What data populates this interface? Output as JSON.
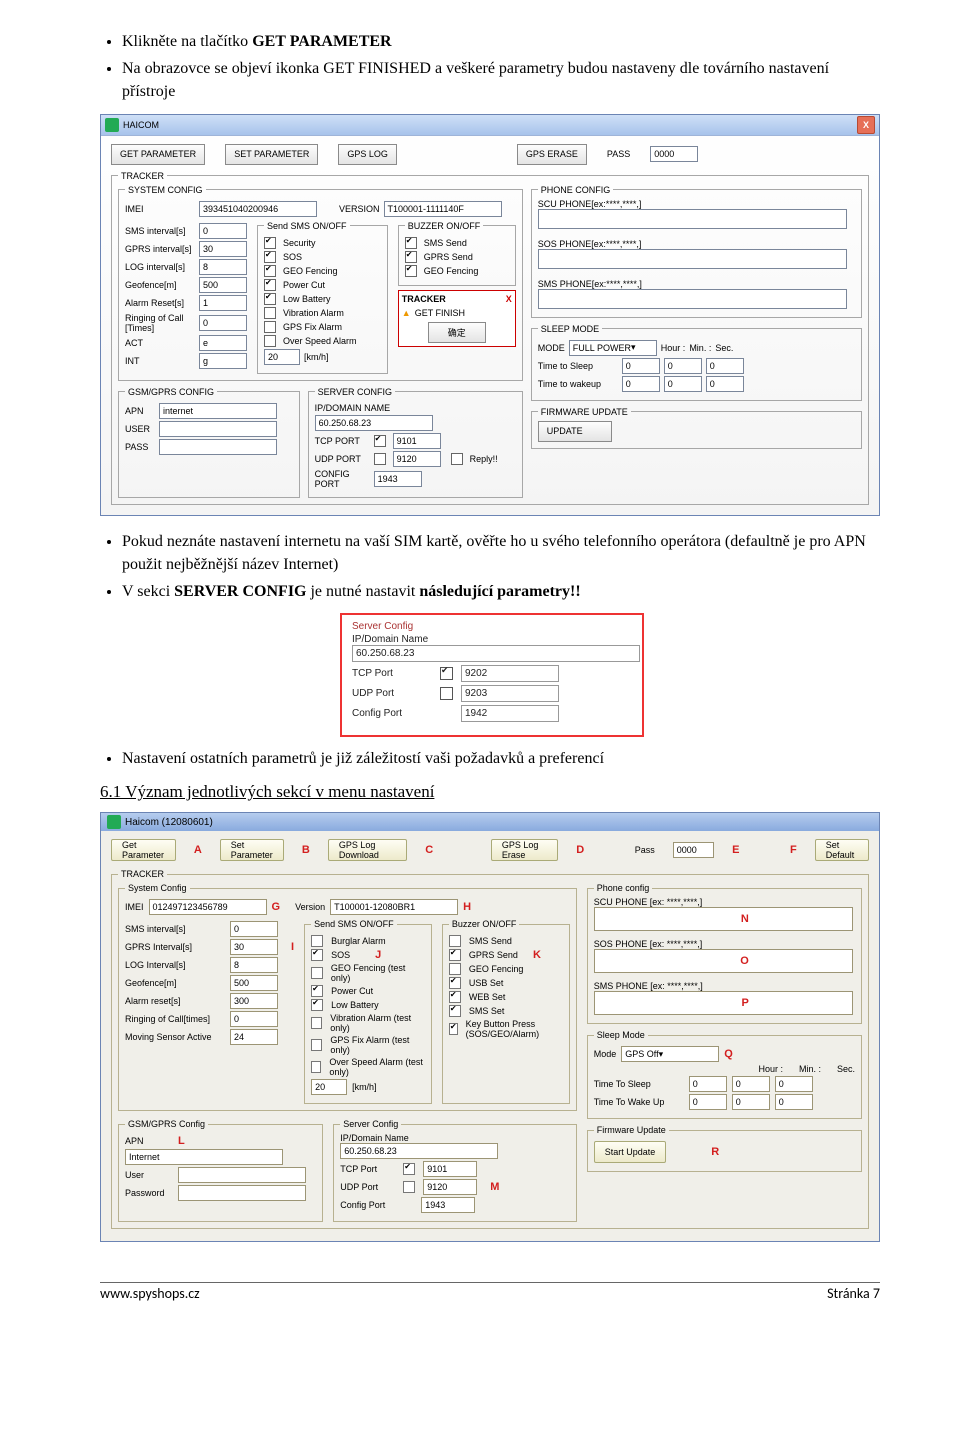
{
  "doc": {
    "bullet1_a": "Klikněte na tlačítko ",
    "bullet1_b": "GET PARAMETER",
    "bullet2": "Na obrazovce se objeví ikonka GET FINISHED a veškeré parametry budou nastaveny dle továrního nastavení přístroje",
    "bullet3": "Pokud neznáte nastavení internetu na vaší SIM kartě, ověřte ho u svého telefonního operátora (defaultně je pro APN použit nejběžnější název Internet)",
    "bullet4_a": "V sekci ",
    "bullet4_b": "SERVER CONFIG",
    "bullet4_c": " je nutné nastavit ",
    "bullet4_d": "následující parametry!!",
    "bullet5": "Nastavení ostatních parametrů je již záležitostí vaši požadavků a preferencí",
    "section61": "6.1 Význam jednotlivých sekcí v menu nastavení"
  },
  "shot1": {
    "title": "HAICOM",
    "btn_get": "GET PARAMETER",
    "btn_set": "SET PARAMETER",
    "btn_log": "GPS LOG",
    "btn_erase": "GPS ERASE",
    "pass_label": "PASS",
    "pass_value": "0000",
    "tracker": "TRACKER",
    "system_config": "SYSTEM CONFIG",
    "imei_lbl": "IMEI",
    "imei_val": "393451040200946",
    "version_lbl": "VERSION",
    "version_val": "T100001-1111140F",
    "fields": [
      {
        "l": "SMS interval[s]",
        "v": "0"
      },
      {
        "l": "GPRS interval[s]",
        "v": "30"
      },
      {
        "l": "LOG interval[s]",
        "v": "8"
      },
      {
        "l": "Geofence[m]",
        "v": "500"
      },
      {
        "l": "Alarm Reset[s]",
        "v": "1"
      },
      {
        "l": "Ringing of Call [Times]",
        "v": "0"
      },
      {
        "l": "ACT",
        "v": "e"
      },
      {
        "l": "INT",
        "v": "g"
      }
    ],
    "send_title": "Send SMS ON/OFF",
    "send_items": [
      "Security",
      "SOS",
      "GEO Fencing",
      "Power Cut",
      "Low Battery",
      "Vibration Alarm",
      "GPS Fix Alarm",
      "Over Speed Alarm"
    ],
    "send_checked": [
      true,
      true,
      true,
      true,
      true,
      false,
      false,
      false
    ],
    "speed_val": "20",
    "speed_unit": "[km/h]",
    "buzzer_title": "BUZZER ON/OFF",
    "buzzer_items": [
      "SMS Send",
      "GPRS Send",
      "GEO Fencing"
    ],
    "buzzer_checked": [
      true,
      true,
      true
    ],
    "popup_title": "TRACKER",
    "popup_msg": "GET FINISH",
    "phone_config": "PHONE CONFIG",
    "scu_lbl": "SCU PHONE[ex:****,****,]",
    "sos_lbl": "SOS PHONE[ex:****,****,]",
    "sms_lbl": "SMS PHONE[ex:****,****,]",
    "gsm_title": "GSM/GPRS CONFIG",
    "apn_lbl": "APN",
    "apn_val": "internet",
    "user_lbl": "USER",
    "pass_lbl": "PASS",
    "server_title": "SERVER CONFIG",
    "ipdn_lbl": "IP/DOMAIN NAME",
    "ipdn_val": "60.250.68.23",
    "tcp_lbl": "TCP PORT",
    "tcp_val": "9101",
    "udp_lbl": "UDP PORT",
    "udp_val": "9120",
    "cfg_lbl": "CONFIG PORT",
    "cfg_val": "1943",
    "replyq": "Reply!!",
    "sleep_title": "SLEEP MODE",
    "mode_lbl": "MODE",
    "mode_val": "FULL POWER",
    "hour": "Hour :",
    "min": "Min. :",
    "sec": "Sec.",
    "tts": "Time to Sleep",
    "ttw": "Time to wakeup",
    "zero": "0",
    "fw_title": "FIRMWARE UPDATE",
    "update": "UPDATE"
  },
  "shot2": {
    "title": "Server Config",
    "ipdn_lbl": "IP/Domain Name",
    "ipdn_val": "60.250.68.23",
    "tcp_lbl": "TCP Port",
    "tcp_val": "9202",
    "udp_lbl": "UDP Port",
    "udp_val": "9203",
    "cfg_lbl": "Config Port",
    "cfg_val": "1942"
  },
  "shot3": {
    "title": "Haicom (12080601)",
    "btn_get": "Get Parameter",
    "btn_set": "Set Parameter",
    "btn_dl": "GPS Log Download",
    "btn_er": "GPS Log Erase",
    "pass_lbl": "Pass",
    "pass_val": "0000",
    "btn_def": "Set Default",
    "letters": {
      "A": "A",
      "B": "B",
      "C": "C",
      "D": "D",
      "E": "E",
      "F": "F",
      "G": "G",
      "H": "H",
      "I": "I",
      "J": "J",
      "K": "K",
      "L": "L",
      "M": "M",
      "N": "N",
      "O": "O",
      "P": "P",
      "Q": "Q",
      "R": "R"
    },
    "tracker": "TRACKER",
    "syscfg": "System Config",
    "imei_lbl": "IMEI",
    "imei_val": "012497123456789",
    "ver_lbl": "Version",
    "ver_val": "T100001-12080BR1",
    "leftfields": [
      {
        "l": "SMS interval[s]",
        "v": "0"
      },
      {
        "l": "GPRS Interval[s]",
        "v": "30"
      },
      {
        "l": "LOG Interval[s]",
        "v": "8"
      },
      {
        "l": "Geofence[m]",
        "v": "500"
      },
      {
        "l": "Alarm reset[s]",
        "v": "300"
      },
      {
        "l": "Ringing of Call[times]",
        "v": "0"
      },
      {
        "l": "Moving Sensor Active",
        "v": "24"
      }
    ],
    "sendtitle": "Send SMS ON/OFF",
    "senditems": [
      "Burglar Alarm",
      "SOS",
      "GEO Fencing (test only)",
      "Power Cut",
      "Low Battery",
      "Vibration Alarm (test only)",
      "GPS Fix Alarm (test only)",
      "Over Speed Alarm (test only)"
    ],
    "sendchecked": [
      false,
      true,
      false,
      true,
      true,
      false,
      false,
      false
    ],
    "speed": "20",
    "speedunit": "[km/h]",
    "buztitle": "Buzzer ON/OFF",
    "buzitems": [
      "SMS Send",
      "GPRS Send",
      "GEO Fencing",
      "USB Set",
      "WEB Set",
      "SMS Set",
      "Key Button Press (SOS/GEO/Alarm)"
    ],
    "buzchecked": [
      false,
      true,
      false,
      true,
      true,
      true,
      true
    ],
    "phonecfg": "Phone config",
    "scu": "SCU PHONE [ex: ****,****,]",
    "sos": "SOS PHONE [ex: ****,****,]",
    "sms": "SMS PHONE [ex: ****,****,]",
    "gsm": "GSM/GPRS Config",
    "apn": "APN",
    "apn_val": "Internet",
    "user": "User",
    "pwd": "Password",
    "srv": "Server Config",
    "ipdn": "IP/Domain Name",
    "ipdn_val": "60.250.68.23",
    "tcp": "TCP Port",
    "tcp_val": "9101",
    "udp": "UDP Port",
    "udp_val": "9120",
    "cfg": "Config Port",
    "cfg_val": "1943",
    "sleep": "Sleep Mode",
    "mode": "Mode",
    "mode_val": "GPS Off",
    "hour": "Hour :",
    "min": "Min. :",
    "sec": "Sec.",
    "tts": "Time To Sleep",
    "ttw": "Time To Wake Up",
    "zero": "0",
    "fw": "Firmware Update",
    "start": "Start Update"
  },
  "footer": {
    "site": "www.spyshops.cz",
    "page": "Stránka 7"
  }
}
